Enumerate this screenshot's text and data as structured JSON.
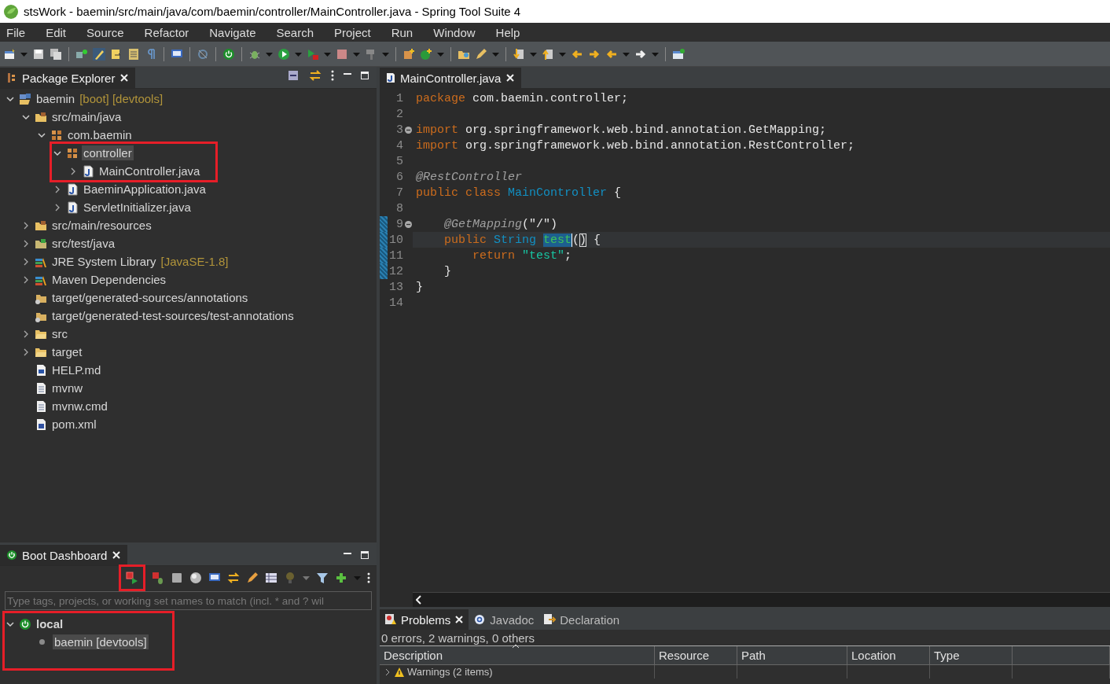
{
  "window": {
    "title": "stsWork - baemin/src/main/java/com/baemin/controller/MainController.java - Spring Tool Suite 4"
  },
  "menu": [
    "File",
    "Edit",
    "Source",
    "Refactor",
    "Navigate",
    "Search",
    "Project",
    "Run",
    "Window",
    "Help"
  ],
  "package_explorer": {
    "tab": {
      "label": "Package Explorer",
      "selected": true
    },
    "tree": [
      {
        "label": "baemin",
        "decoration": "[boot] [devtools]",
        "kind": "project",
        "expanded": true,
        "selected": false,
        "children": [
          {
            "label": "src/main/java",
            "kind": "source-folder",
            "expanded": true,
            "selected": false,
            "children": [
              {
                "label": "com.baemin",
                "kind": "package",
                "expanded": true,
                "selected": false,
                "children": [
                  {
                    "label": "controller",
                    "kind": "package",
                    "expanded": true,
                    "selected": true,
                    "boxed": true,
                    "children": [
                      {
                        "label": "MainController.java",
                        "kind": "java",
                        "expanded": false,
                        "selected": false
                      }
                    ]
                  },
                  {
                    "label": "BaeminApplication.java",
                    "kind": "java",
                    "expanded": false,
                    "selected": false
                  },
                  {
                    "label": "ServletInitializer.java",
                    "kind": "java",
                    "expanded": false,
                    "selected": false
                  }
                ]
              }
            ]
          },
          {
            "label": "src/main/resources",
            "kind": "source-folder",
            "expanded": false,
            "selected": false
          },
          {
            "label": "src/test/java",
            "kind": "test-folder",
            "expanded": false,
            "selected": false
          },
          {
            "label": "JRE System Library",
            "decoration": "[JavaSE-1.8]",
            "kind": "library",
            "expanded": false,
            "selected": false
          },
          {
            "label": "Maven Dependencies",
            "kind": "library",
            "expanded": false,
            "selected": false
          },
          {
            "label": "target/generated-sources/annotations",
            "kind": "generated-folder",
            "selected": false
          },
          {
            "label": "target/generated-test-sources/test-annotations",
            "kind": "generated-folder",
            "selected": false
          },
          {
            "label": "src",
            "kind": "folder",
            "expanded": false,
            "selected": false
          },
          {
            "label": "target",
            "kind": "folder",
            "expanded": false,
            "selected": false
          },
          {
            "label": "HELP.md",
            "kind": "word-file",
            "selected": false
          },
          {
            "label": "mvnw",
            "kind": "text-file",
            "selected": false
          },
          {
            "label": "mvnw.cmd",
            "kind": "text-file",
            "selected": false
          },
          {
            "label": "pom.xml",
            "kind": "maven-file",
            "selected": false
          }
        ]
      }
    ]
  },
  "boot_dashboard": {
    "tab": {
      "label": "Boot Dashboard",
      "selected": true
    },
    "toolbar": [
      {
        "boxed": true
      },
      {
        "boxed": false
      },
      {
        "boxed": false
      },
      {
        "boxed": false
      },
      {
        "boxed": false
      },
      {
        "boxed": false
      },
      {
        "boxed": false
      },
      {
        "boxed": false
      },
      {
        "boxed": false
      },
      {
        "boxed": false
      },
      {
        "boxed": false
      }
    ],
    "filter": {
      "placeholder": "Type tags, projects, or working set names to match (incl. * and ? wil"
    },
    "tree": [
      {
        "label": "local",
        "kind": "target",
        "expanded": true,
        "selected": false,
        "boxed": true,
        "children": [
          {
            "label": "baemin [devtools]",
            "kind": "app",
            "running": false,
            "selected": true
          }
        ]
      }
    ]
  },
  "editor": {
    "tabs": [
      {
        "label": "MainController.java",
        "selected": true
      }
    ],
    "lines": [
      {
        "number": "1",
        "tokens": [
          {
            "kind": "keyword",
            "text": "package"
          },
          {
            "kind": "plain",
            "text": " com.baemin.controller;"
          }
        ]
      },
      {
        "number": "2"
      },
      {
        "number": "3",
        "collapsed": false,
        "tokens": [
          {
            "kind": "keyword",
            "text": "import"
          },
          {
            "kind": "plain",
            "text": " org.springframework.web.bind.annotation.GetMapping;"
          }
        ]
      },
      {
        "number": "4",
        "tokens": [
          {
            "kind": "keyword",
            "text": "import"
          },
          {
            "kind": "plain",
            "text": " org.springframework.web.bind.annotation.RestController;"
          }
        ]
      },
      {
        "number": "5"
      },
      {
        "number": "6",
        "tokens": [
          {
            "kind": "annotation",
            "text": "@RestController"
          }
        ]
      },
      {
        "number": "7",
        "tokens": [
          {
            "kind": "keyword",
            "text": "public class "
          },
          {
            "kind": "class",
            "text": "MainController"
          },
          {
            "kind": "plain",
            "text": " {"
          }
        ]
      },
      {
        "number": "8"
      },
      {
        "number": "9",
        "collapsed": false,
        "changed": true,
        "tokens": [
          {
            "kind": "annotation",
            "text": "    @GetMapping"
          },
          {
            "kind": "plain",
            "text": "(\"/\")"
          }
        ]
      },
      {
        "number": "10",
        "changed": true,
        "current": true,
        "tokens": [
          {
            "kind": "keyword",
            "text": "    public "
          },
          {
            "kind": "class",
            "text": "String "
          },
          {
            "kind": "selection",
            "text": "test"
          },
          {
            "kind": "caret",
            "text": "("
          },
          {
            "kind": "bracket",
            "text": ")"
          },
          {
            "kind": "plain",
            "text": " {"
          }
        ]
      },
      {
        "number": "11",
        "changed": true,
        "tokens": [
          {
            "kind": "keyword",
            "text": "        return "
          },
          {
            "kind": "string",
            "text": "\"test\""
          },
          {
            "kind": "plain",
            "text": ";"
          }
        ]
      },
      {
        "number": "12",
        "changed": true,
        "tokens": [
          {
            "kind": "plain",
            "text": "    }"
          }
        ]
      },
      {
        "number": "13",
        "tokens": [
          {
            "kind": "plain",
            "text": "}"
          }
        ]
      },
      {
        "number": "14"
      }
    ]
  },
  "problems": {
    "tabs": [
      {
        "label": "Problems",
        "kind": "problems",
        "selected": true
      },
      {
        "label": "Javadoc",
        "kind": "javadoc",
        "selected": false
      },
      {
        "label": "Declaration",
        "kind": "declaration",
        "selected": false
      }
    ],
    "summary": "0 errors, 2 warnings, 0 others",
    "columns": [
      "Description",
      "Resource",
      "Path",
      "Location",
      "Type"
    ],
    "rows": [
      {
        "label": "Warnings (2 items)",
        "kind": "warning",
        "expanded": false
      }
    ]
  }
}
